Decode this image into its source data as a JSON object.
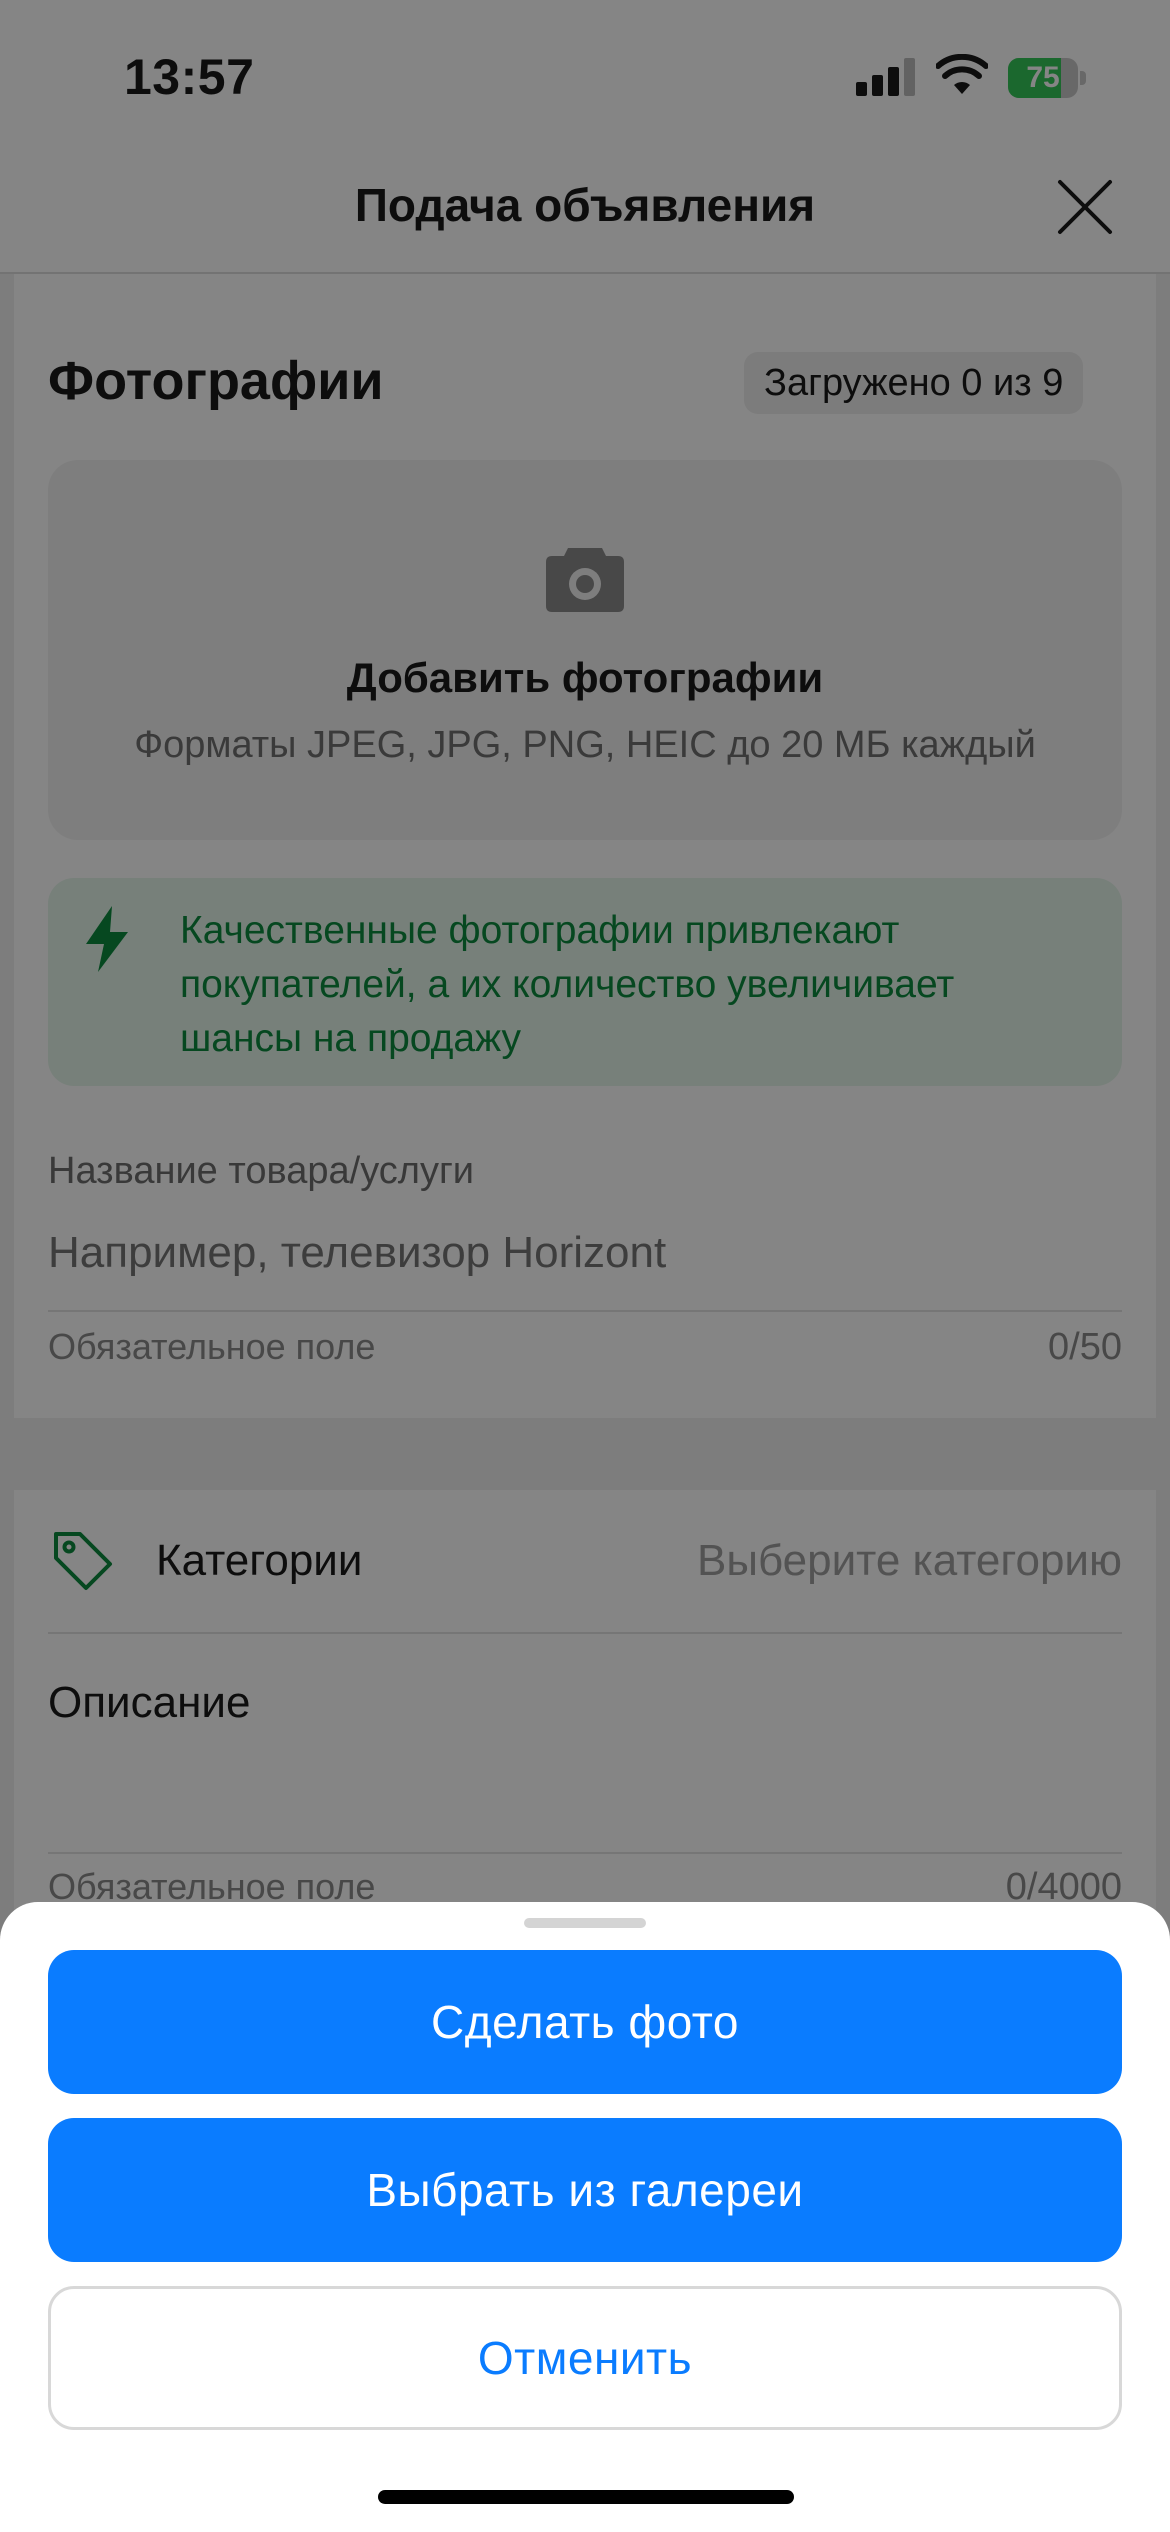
{
  "status_bar": {
    "time": "13:57",
    "battery": "75",
    "battery_level": 0.75
  },
  "nav": {
    "title": "Подача объявления"
  },
  "photos": {
    "title": "Фотографии",
    "uploaded": "Загружено 0 из 9",
    "add_label": "Добавить фотографии",
    "formats": "Форматы JPEG, JPG, PNG, HEIC до 20 МБ каждый",
    "tip": "Качественные фотографии привлекают покупателей, а их количество увеличивает шансы на продажу"
  },
  "title_field": {
    "label": "Название товара/услуги",
    "placeholder": "Например, телевизор Horizont",
    "hint": "Обязательное поле",
    "counter": "0/50"
  },
  "category": {
    "label": "Категории",
    "value": "Выберите категорию"
  },
  "description": {
    "label": "Описание",
    "hint": "Обязательное поле",
    "counter": "0/4000"
  },
  "sheet": {
    "take_photo": "Сделать фото",
    "choose_gallery": "Выбрать из галереи",
    "cancel": "Отменить"
  },
  "colors": {
    "accent": "#0a7cff",
    "tip_green": "#0d8a3f",
    "battery_green": "#34c759"
  }
}
